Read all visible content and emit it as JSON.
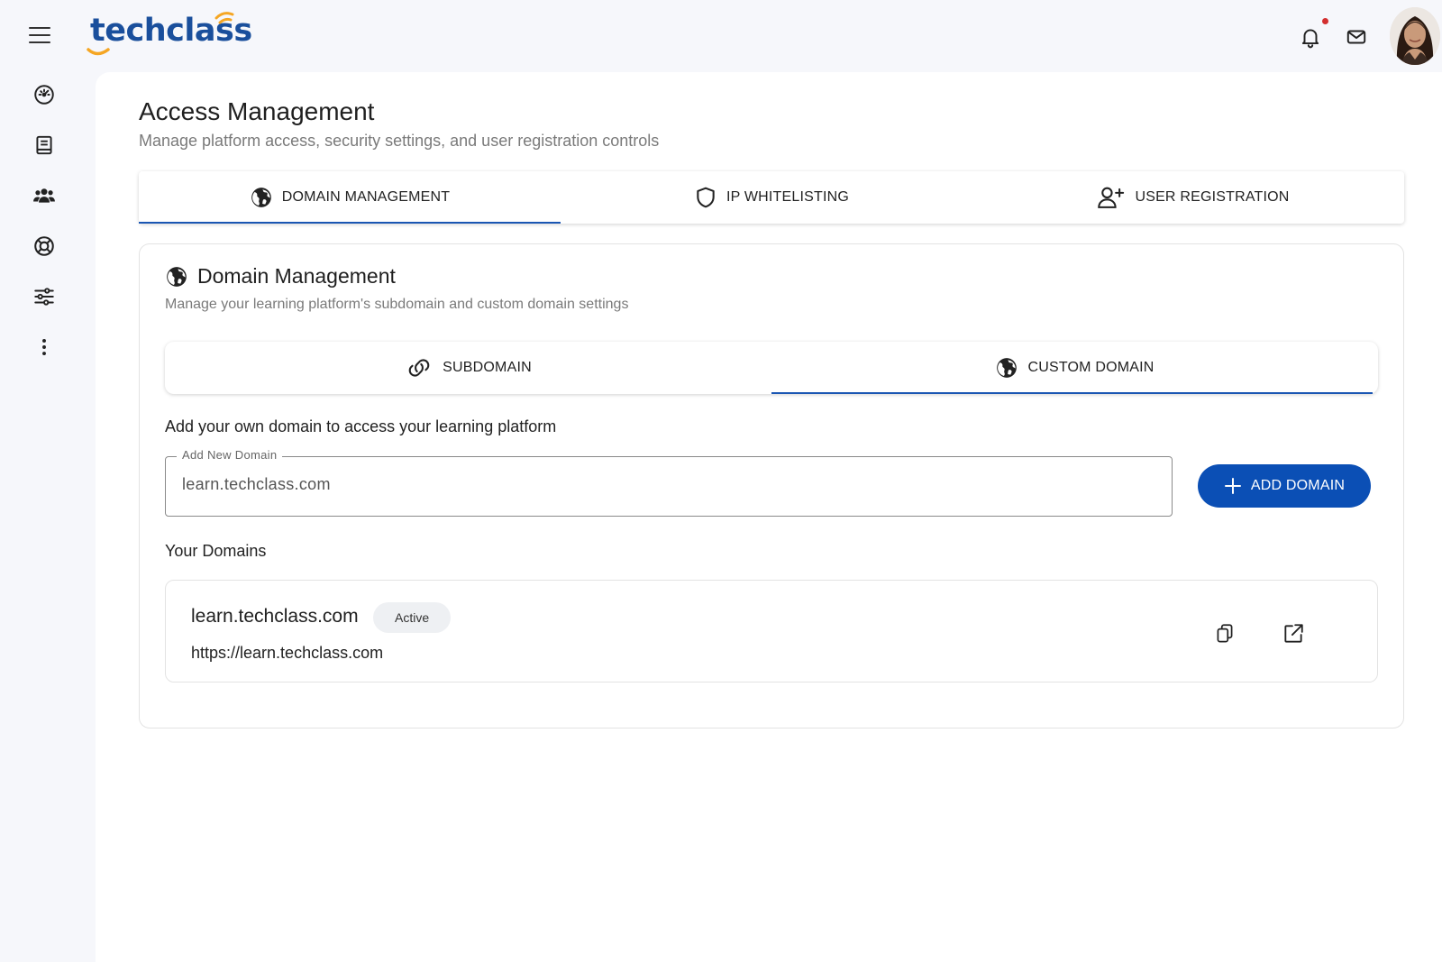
{
  "brand": {
    "name": "techclass",
    "accent": "#0b4fb5",
    "logo_color": "#1a4f9c",
    "smile_color": "#f5a623"
  },
  "header": {
    "icons": [
      "menu-icon",
      "bell-icon",
      "mail-icon"
    ],
    "notification_dot_color": "#d32f2f"
  },
  "sidebar": {
    "items": [
      {
        "icon": "dashboard-gauge-icon"
      },
      {
        "icon": "book-icon"
      },
      {
        "icon": "users-icon"
      },
      {
        "icon": "support-lifebuoy-icon"
      },
      {
        "icon": "sliders-icon"
      },
      {
        "icon": "more-vertical-icon"
      }
    ]
  },
  "page": {
    "title": "Access Management",
    "subtitle": "Manage platform access, security settings, and user registration controls"
  },
  "main_tabs": [
    {
      "label": "DOMAIN MANAGEMENT",
      "icon": "globe-icon",
      "active": true
    },
    {
      "label": "IP WHITELISTING",
      "icon": "shield-icon",
      "active": false
    },
    {
      "label": "USER REGISTRATION",
      "icon": "user-plus-icon",
      "active": false
    }
  ],
  "card": {
    "title": "Domain Management",
    "subtitle": "Manage your learning platform's subdomain and custom domain settings",
    "sub_tabs": [
      {
        "label": "SUBDOMAIN",
        "icon": "link-icon",
        "active": false
      },
      {
        "label": "CUSTOM DOMAIN",
        "icon": "globe-icon",
        "active": true
      }
    ],
    "description": "Add your own domain to access your learning platform",
    "field": {
      "label": "Add New Domain",
      "value": "learn.techclass.com"
    },
    "add_button_label": "ADD DOMAIN",
    "domains_label": "Your Domains",
    "domains": [
      {
        "name": "learn.techclass.com",
        "status": "Active",
        "url": "https://learn.techclass.com"
      }
    ]
  }
}
